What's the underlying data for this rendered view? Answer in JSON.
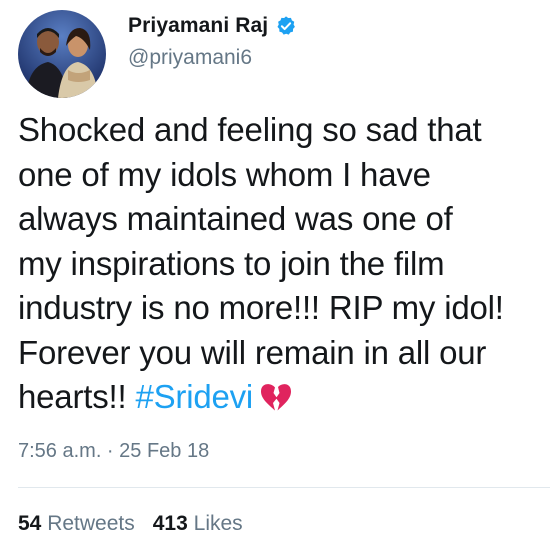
{
  "user": {
    "display_name": "Priyamani Raj",
    "handle": "@priyamani6",
    "verified": true
  },
  "tweet": {
    "lines": [
      "Shocked and feeling so sad that",
      "one of my idols whom I have",
      "always maintained was one of",
      "my inspirations to join the film",
      "industry is no more!!! RIP my idol!",
      "Forever you will remain in all our"
    ],
    "last_line_text": "hearts!! ",
    "hashtag": "#Sridevi",
    "emoji": "broken-heart-icon"
  },
  "meta": {
    "timestamp": "7:56 a.m. · 25 Feb 18"
  },
  "stats": {
    "retweets_count": "54",
    "retweets_label": "Retweets",
    "likes_count": "413",
    "likes_label": "Likes"
  },
  "colors": {
    "link": "#1da1f2",
    "secondary_text": "#657786",
    "primary_text": "#14171a",
    "heart": "#e0245e"
  }
}
